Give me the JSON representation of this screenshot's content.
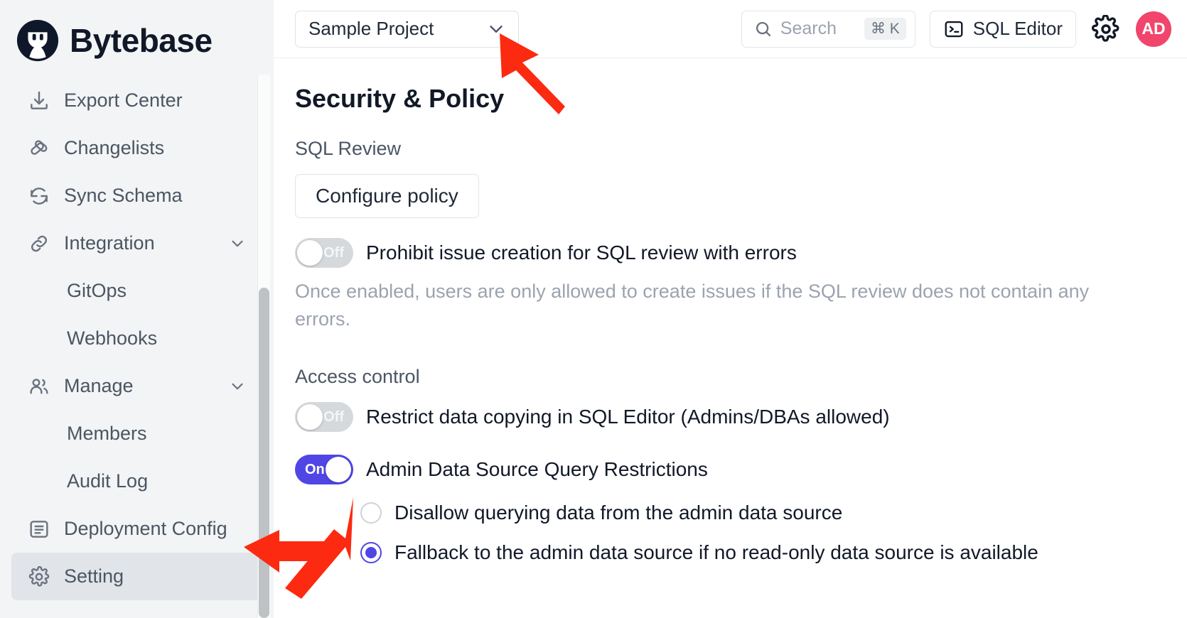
{
  "brand": {
    "name": "Bytebase",
    "logo_icon": "bytebase-logo-icon"
  },
  "sidebar": {
    "items": [
      {
        "label": "Export Center",
        "icon": "download-icon",
        "type": "top",
        "chevron": false,
        "active": false
      },
      {
        "label": "Changelists",
        "icon": "changelist-icon",
        "type": "top",
        "chevron": false,
        "active": false
      },
      {
        "label": "Sync Schema",
        "icon": "sync-icon",
        "type": "top",
        "chevron": false,
        "active": false
      },
      {
        "label": "Integration",
        "icon": "link-icon",
        "type": "top",
        "chevron": true,
        "active": false
      },
      {
        "label": "GitOps",
        "icon": "",
        "type": "sub",
        "chevron": false,
        "active": false
      },
      {
        "label": "Webhooks",
        "icon": "",
        "type": "sub",
        "chevron": false,
        "active": false
      },
      {
        "label": "Manage",
        "icon": "users-icon",
        "type": "top",
        "chevron": true,
        "active": false
      },
      {
        "label": "Members",
        "icon": "",
        "type": "sub",
        "chevron": false,
        "active": false
      },
      {
        "label": "Audit Log",
        "icon": "",
        "type": "sub",
        "chevron": false,
        "active": false
      },
      {
        "label": "Deployment Config",
        "icon": "deployment-icon",
        "type": "top",
        "chevron": false,
        "active": false
      },
      {
        "label": "Setting",
        "icon": "gear-icon",
        "type": "top",
        "chevron": false,
        "active": true
      }
    ]
  },
  "topbar": {
    "project": {
      "value": "Sample Project",
      "chevron_icon": "chevron-down-icon"
    },
    "search": {
      "placeholder": "Search",
      "shortcut": "⌘ K",
      "icon": "search-icon"
    },
    "sql_editor": {
      "label": "SQL Editor",
      "icon": "terminal-icon"
    },
    "settings_icon": "gear-icon",
    "avatar": {
      "initials": "AD",
      "color": "#f1456b"
    }
  },
  "main": {
    "page_title": "Security & Policy",
    "sql_review": {
      "section_label": "SQL Review",
      "configure_button": "Configure policy",
      "prohibit_toggle": {
        "state": "Off",
        "label": "Prohibit issue creation for SQL review with errors"
      },
      "prohibit_description": "Once enabled, users are only allowed to create issues if the SQL review does not contain any errors."
    },
    "access_control": {
      "section_label": "Access control",
      "restrict_copy_toggle": {
        "state": "Off",
        "label": "Restrict data copying in SQL Editor (Admins/DBAs allowed)"
      },
      "admin_restrictions_toggle": {
        "state": "On",
        "label": "Admin Data Source Query Restrictions"
      },
      "radios": [
        {
          "label": "Disallow querying data from the admin data source",
          "checked": false
        },
        {
          "label": "Fallback to the admin data source if no read-only data source is available",
          "checked": true
        }
      ]
    }
  },
  "annotations": {
    "arrow_color": "#fc2a10",
    "arrow_project_target": "project-selector",
    "arrow_setting_target": "sidebar-item-setting",
    "arrow_toggle_target": "admin-data-source-toggle"
  },
  "colors": {
    "accent": "#4f46e5",
    "sidebar_bg": "#f2f4f5",
    "avatar": "#f1456b",
    "muted_text": "#9ca3af"
  }
}
